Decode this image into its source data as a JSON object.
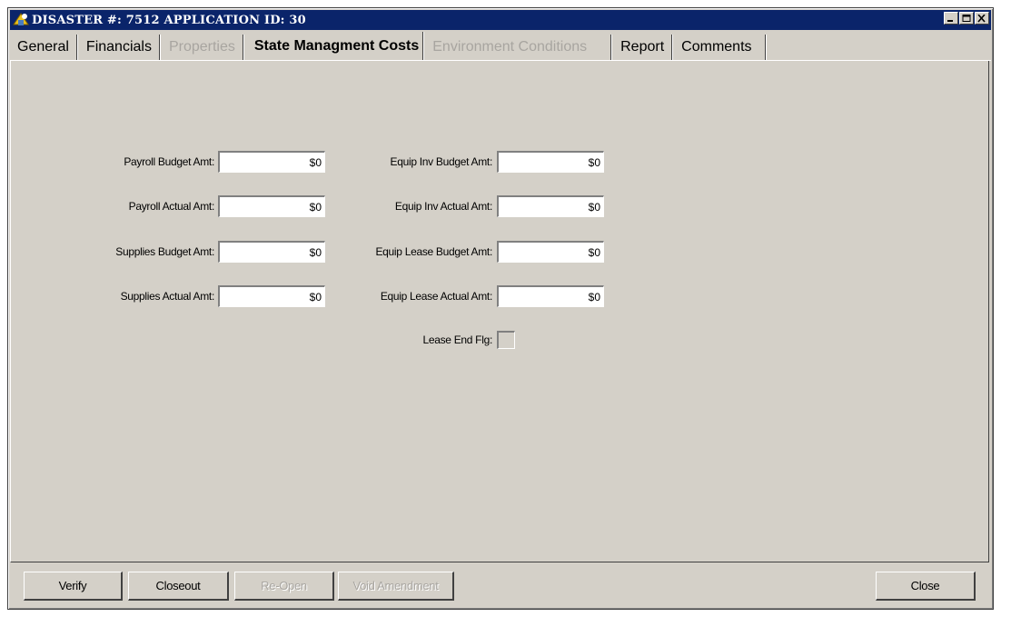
{
  "window": {
    "title": "DISASTER #: 7512  APPLICATION ID: 30"
  },
  "tabs": [
    {
      "label": "General",
      "state": "enabled"
    },
    {
      "label": "Financials",
      "state": "enabled"
    },
    {
      "label": "Properties",
      "state": "disabled"
    },
    {
      "label": "State Managment Costs",
      "state": "active"
    },
    {
      "label": "Environment Conditions",
      "state": "disabled"
    },
    {
      "label": "Report",
      "state": "enabled"
    },
    {
      "label": "Comments",
      "state": "enabled"
    }
  ],
  "form": {
    "payroll_budget": {
      "label": "Payroll Budget Amt:",
      "value": "$0"
    },
    "payroll_actual": {
      "label": "Payroll Actual Amt:",
      "value": "$0"
    },
    "supplies_budget": {
      "label": "Supplies Budget Amt:",
      "value": "$0"
    },
    "supplies_actual": {
      "label": "Supplies Actual Amt:",
      "value": "$0"
    },
    "equip_inv_budget": {
      "label": "Equip Inv Budget Amt:",
      "value": "$0"
    },
    "equip_inv_actual": {
      "label": "Equip Inv Actual Amt:",
      "value": "$0"
    },
    "equip_lease_budget": {
      "label": "Equip Lease Budget Amt:",
      "value": "$0"
    },
    "equip_lease_actual": {
      "label": "Equip Lease Actual Amt:",
      "value": "$0"
    },
    "lease_end_flg": {
      "label": "Lease End Flg:",
      "checked": false
    }
  },
  "buttons": {
    "verify": "Verify",
    "closeout": "Closeout",
    "reopen": "Re-Open",
    "void_amendment": "Void Amendment",
    "close": "Close"
  },
  "colors": {
    "titlebar": "#0a246a",
    "face": "#d4d0c8",
    "disabled_text": "#a8a5a0"
  }
}
